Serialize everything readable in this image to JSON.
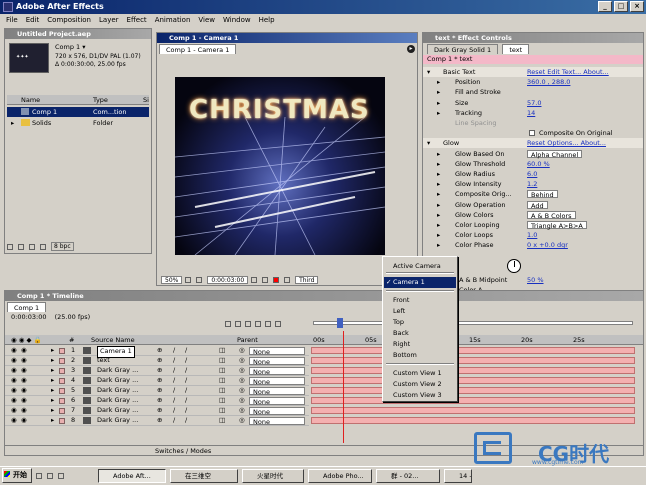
{
  "app": {
    "title": "Adobe After Effects"
  },
  "menu": [
    "File",
    "Edit",
    "Composition",
    "Layer",
    "Effect",
    "Animation",
    "View",
    "Window",
    "Help"
  ],
  "project": {
    "title": "Untitled Project.aep",
    "comp_name": "Comp 1 ▾",
    "comp_info1": "720 x 576, D1/DV PAL (1.07)",
    "comp_info2": "Δ 0:00:30:00, 25.00 fps",
    "col_name": "Name",
    "col_type": "Type",
    "col_size": "Si",
    "items": [
      {
        "name": "Comp 1",
        "type": "Com...tion"
      },
      {
        "name": "Solids",
        "type": "Folder"
      }
    ],
    "bpc": "8 bpc"
  },
  "comp_window": {
    "title": "Comp 1 - Camera 1",
    "tab": "Comp 1 - Camera 1",
    "image_text": "CHRISTMAS",
    "zoom": "50%",
    "timecode": "0:00:03:00",
    "view_sel": "Third"
  },
  "effects": {
    "title": "text * Effect Controls",
    "tab1": "Dark Gray Solid 1",
    "tab2": "text",
    "layer_label": "Comp 1 * text",
    "rows": [
      {
        "label": "Basic Text",
        "value": "Reset  Edit Text...  About...",
        "kind": "head"
      },
      {
        "label": "Position",
        "value": "360.0 , 288.0",
        "kind": "val"
      },
      {
        "label": "Fill and Stroke",
        "value": "",
        "kind": "plain"
      },
      {
        "label": "Size",
        "value": "57.0",
        "kind": "val"
      },
      {
        "label": "Tracking",
        "value": "14",
        "kind": "val"
      },
      {
        "label": "Line Spacing",
        "value": "",
        "kind": "gray"
      },
      {
        "label": "",
        "value": "Composite On Original",
        "kind": "check"
      },
      {
        "label": "Glow",
        "value": "Reset  Options...  About...",
        "kind": "head"
      },
      {
        "label": "Glow Based On",
        "value": "Alpha Channel",
        "kind": "dd"
      },
      {
        "label": "Glow Threshold",
        "value": "60.0 %",
        "kind": "val"
      },
      {
        "label": "Glow Radius",
        "value": "6.0",
        "kind": "val"
      },
      {
        "label": "Glow Intensity",
        "value": "1.2",
        "kind": "val"
      },
      {
        "label": "Composite Orig...",
        "value": "Behind",
        "kind": "dd"
      },
      {
        "label": "Glow Operation",
        "value": "Add",
        "kind": "dd"
      },
      {
        "label": "Glow Colors",
        "value": "A & B Colors",
        "kind": "dd"
      },
      {
        "label": "Color Looping",
        "value": "Triangle A>B>A",
        "kind": "dd"
      },
      {
        "label": "Color Loops",
        "value": "1.0",
        "kind": "val"
      },
      {
        "label": "Color Phase",
        "value": "0 x +0.0 dgr",
        "kind": "val"
      }
    ],
    "midpoint_label": "A & B Midpoint",
    "midpoint_value": "50 %",
    "color_a": "Color A"
  },
  "context_menu": {
    "items": [
      "Active Camera",
      "Camera 1",
      "Front",
      "Left",
      "Top",
      "Back",
      "Right",
      "Bottom",
      "Custom View 1",
      "Custom View 2",
      "Custom View 3"
    ],
    "selected": "Camera 1"
  },
  "timeline": {
    "title": "Comp 1 * Timeline",
    "tab": "Comp 1",
    "timecode": "0:00:03:00",
    "fps": "(25.00 fps)",
    "col_source": "Source Name",
    "col_parent": "Parent",
    "layers": [
      {
        "num": "1",
        "name": "Camera 1",
        "parent": "None",
        "color": "#e8b0b0"
      },
      {
        "num": "2",
        "name": "text",
        "parent": "None",
        "color": "#e8b0b0"
      },
      {
        "num": "3",
        "name": "Dark Gray ...",
        "parent": "None",
        "color": "#e8b0b0"
      },
      {
        "num": "4",
        "name": "Dark Gray ...",
        "parent": "None",
        "color": "#e8b0b0"
      },
      {
        "num": "5",
        "name": "Dark Gray ...",
        "parent": "None",
        "color": "#e8b0b0"
      },
      {
        "num": "6",
        "name": "Dark Gray ...",
        "parent": "None",
        "color": "#e8b0b0"
      },
      {
        "num": "7",
        "name": "Dark Gray ...",
        "parent": "None",
        "color": "#e8b0b0"
      },
      {
        "num": "8",
        "name": "Dark Gray ...",
        "parent": "None",
        "color": "#e8b0b0"
      }
    ],
    "ruler": [
      "00s",
      "05s",
      "10s",
      "15s",
      "20s",
      "25s"
    ],
    "switches_label": "Switches / Modes"
  },
  "taskbar": {
    "start": "开始",
    "buttons": [
      "Adobe Aft...",
      "在三维空",
      "火星时代",
      "Adobe Pho...",
      "群 - 02...",
      "14 -..."
    ]
  },
  "watermark": {
    "brand": "CG时代",
    "url": "www.cgtime.com"
  },
  "colors": {
    "title_active": "#0a246a",
    "face": "#d4d0c8",
    "layer_bar": "#f4b0b0"
  }
}
